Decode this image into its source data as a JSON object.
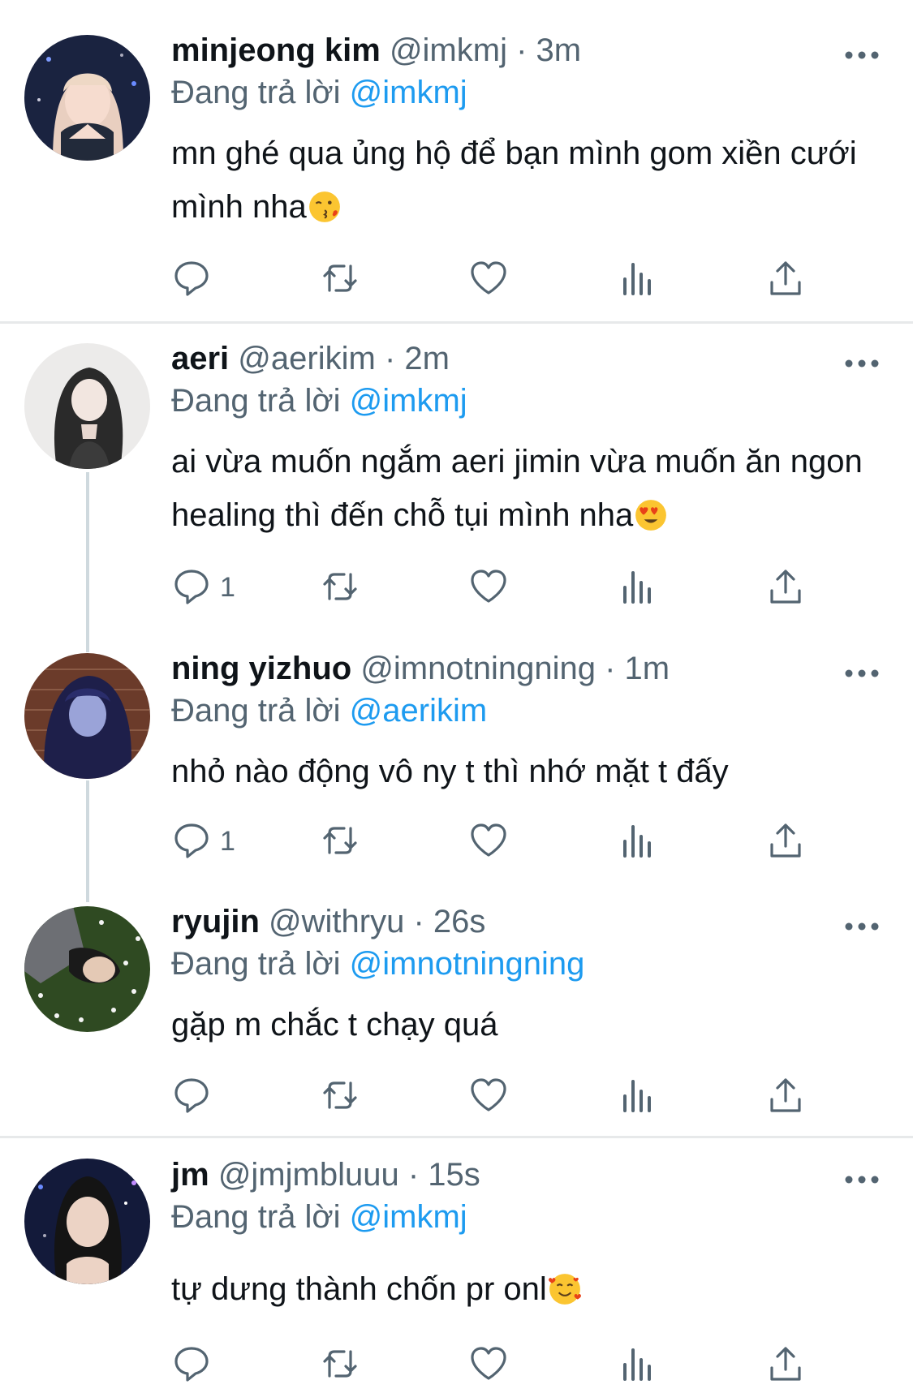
{
  "reply_prefix": "Đang trả lời",
  "colors": {
    "link": "#1d9bf0",
    "secondary": "#536471",
    "text": "#0f1419",
    "divider": "#e7e9ea",
    "thread": "#cfd9de"
  },
  "icons": [
    "more-options-icon",
    "reply-icon",
    "retweet-icon",
    "like-icon",
    "views-icon",
    "share-icon",
    "kissing-heart-emoji",
    "heart-eyes-emoji",
    "smiling-hearts-emoji"
  ],
  "tweets": [
    {
      "name": "minjeong kim",
      "handle": "@imkmj",
      "time": "· 3m",
      "reply_to": "@imkmj",
      "text": "mn ghé qua ủng hộ để bạn mình gom xiền cưới mình nha",
      "emoji": "kissing-heart-emoji",
      "reply_count": ""
    },
    {
      "name": "aeri",
      "handle": "@aerikim",
      "time": "· 2m",
      "reply_to": "@imkmj",
      "text": "ai vừa muốn ngắm aeri jimin vừa muốn ăn ngon healing thì đến chỗ tụi mình nha",
      "emoji": "heart-eyes-emoji",
      "reply_count": "1"
    },
    {
      "name": "ning yizhuo",
      "handle": "@imnotningning",
      "time": "· 1m",
      "reply_to": "@aerikim",
      "text": "nhỏ nào động vô ny t thì nhớ mặt t đấy",
      "emoji": "",
      "reply_count": "1"
    },
    {
      "name": "ryujin",
      "handle": "@withryu",
      "time": "· 26s",
      "reply_to": "@imnotningning",
      "text": "gặp m chắc t chạy quá",
      "emoji": "",
      "reply_count": ""
    },
    {
      "name": "jm",
      "handle": "@jmjmbluuu",
      "time": "· 15s",
      "reply_to": "@imkmj",
      "text": "tự dưng thành chốn pr onl",
      "emoji": "smiling-hearts-emoji",
      "reply_count": ""
    }
  ]
}
